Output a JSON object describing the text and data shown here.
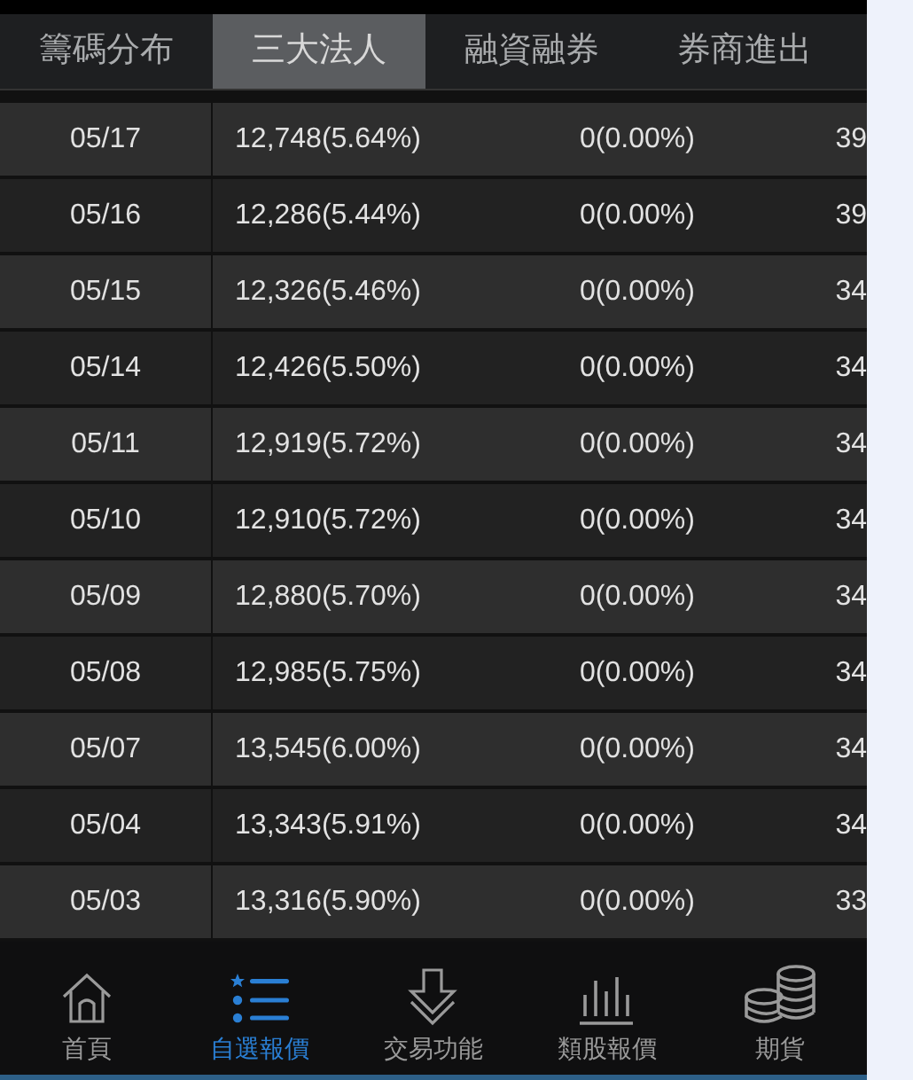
{
  "tabs": [
    {
      "label": "籌碼分布",
      "selected": false
    },
    {
      "label": "三大法人",
      "selected": true
    },
    {
      "label": "融資融券",
      "selected": false
    },
    {
      "label": "券商進出",
      "selected": false
    }
  ],
  "rows": [
    {
      "date": "05/17",
      "column_2": "12,748(5.64%)",
      "column_3": "0(0.00%)",
      "column_4": "39"
    },
    {
      "date": "05/16",
      "column_2": "12,286(5.44%)",
      "column_3": "0(0.00%)",
      "column_4": "39"
    },
    {
      "date": "05/15",
      "column_2": "12,326(5.46%)",
      "column_3": "0(0.00%)",
      "column_4": "34"
    },
    {
      "date": "05/14",
      "column_2": "12,426(5.50%)",
      "column_3": "0(0.00%)",
      "column_4": "34"
    },
    {
      "date": "05/11",
      "column_2": "12,919(5.72%)",
      "column_3": "0(0.00%)",
      "column_4": "34"
    },
    {
      "date": "05/10",
      "column_2": "12,910(5.72%)",
      "column_3": "0(0.00%)",
      "column_4": "34"
    },
    {
      "date": "05/09",
      "column_2": "12,880(5.70%)",
      "column_3": "0(0.00%)",
      "column_4": "34"
    },
    {
      "date": "05/08",
      "column_2": "12,985(5.75%)",
      "column_3": "0(0.00%)",
      "column_4": "34"
    },
    {
      "date": "05/07",
      "column_2": "13,545(6.00%)",
      "column_3": "0(0.00%)",
      "column_4": "34"
    },
    {
      "date": "05/04",
      "column_2": "13,343(5.91%)",
      "column_3": "0(0.00%)",
      "column_4": "34"
    },
    {
      "date": "05/03",
      "column_2": "13,316(5.90%)",
      "column_3": "0(0.00%)",
      "column_4": "33"
    }
  ],
  "nav": [
    {
      "kind": "home",
      "label": "首頁",
      "selected": false
    },
    {
      "kind": "watchlist",
      "label": "自選報價",
      "selected": true
    },
    {
      "kind": "trade",
      "label": "交易功能",
      "selected": false
    },
    {
      "kind": "sector",
      "label": "類股報價",
      "selected": false
    },
    {
      "kind": "futures",
      "label": "期貨",
      "selected": false
    }
  ]
}
